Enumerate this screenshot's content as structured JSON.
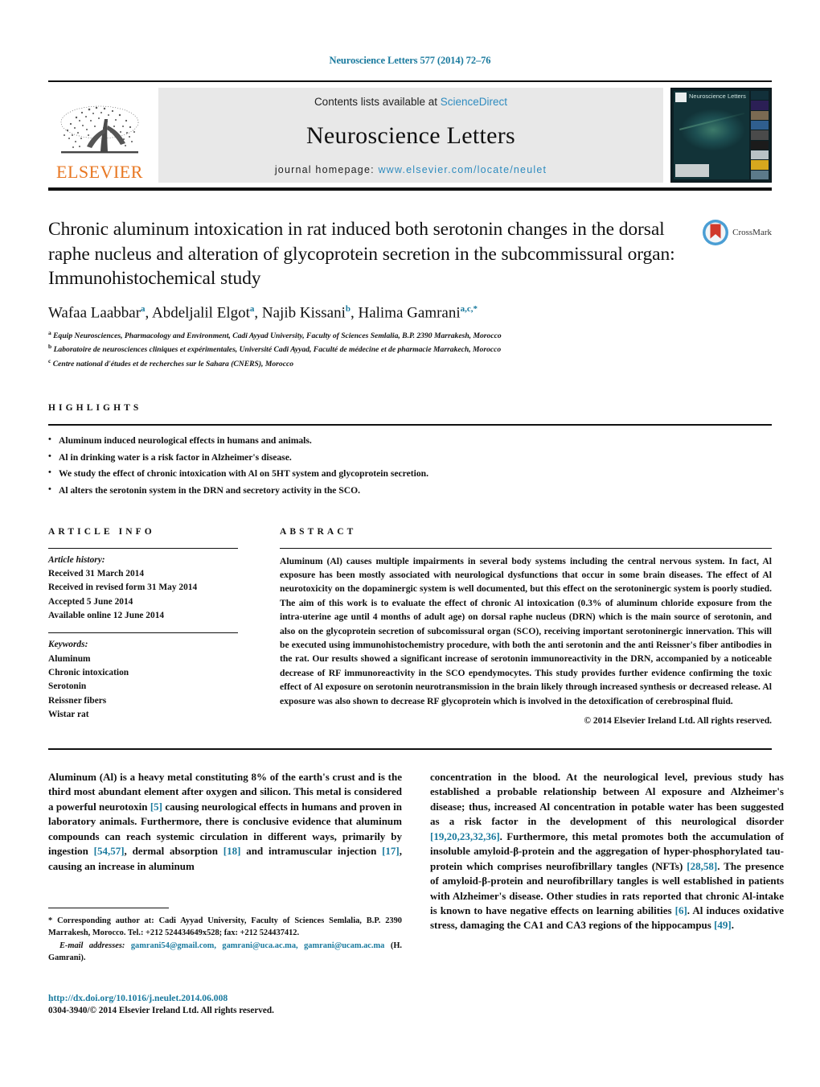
{
  "running_head": "Neuroscience Letters 577 (2014) 72–76",
  "masthead": {
    "publisher_name": "ELSEVIER",
    "contents_prefix": "Contents lists available at ",
    "contents_link": "ScienceDirect",
    "journal_title": "Neuroscience Letters",
    "homepage_prefix": "journal homepage: ",
    "homepage_url": "www.elsevier.com/locate/neulet",
    "cover_title": "Neuroscience Letters",
    "link_color": "#2e8bbf"
  },
  "article": {
    "title": "Chronic aluminum intoxication in rat induced both serotonin changes in the dorsal raphe nucleus and alteration of glycoprotein secretion in the subcommissural organ: Immunohistochemical study",
    "crossmark_label": "CrossMark",
    "authors": [
      {
        "name": "Wafaa Laabbar",
        "marks": "a",
        "sep": ", "
      },
      {
        "name": "Abdeljalil Elgot",
        "marks": "a",
        "sep": ", "
      },
      {
        "name": "Najib Kissani",
        "marks": "b",
        "sep": ", "
      },
      {
        "name": "Halima Gamrani",
        "marks": "a,c,*",
        "sep": ""
      }
    ],
    "affiliations": [
      {
        "mark": "a",
        "text": "Equip Neurosciences, Pharmacology and Environment, Cadi Ayyad University, Faculty of Sciences Semlalia, B.P. 2390 Marrakesh, Morocco"
      },
      {
        "mark": "b",
        "text": "Laboratoire de neurosciences cliniques et expérimentales, Université Cadi Ayyad, Faculté de médecine et de pharmacie Marrakech, Morocco"
      },
      {
        "mark": "c",
        "text": "Centre national d'études et de recherches sur le Sahara (CNERS), Morocco"
      }
    ]
  },
  "highlights": {
    "heading": "HIGHLIGHTS",
    "items": [
      "Aluminum induced neurological effects in humans and animals.",
      "Al in drinking water is a risk factor in Alzheimer's disease.",
      "We study the effect of chronic intoxication with Al on 5HT system and glycoprotein secretion.",
      "Al alters the serotonin system in the DRN and secretory activity in the SCO."
    ]
  },
  "article_info": {
    "heading": "ARTICLE INFO",
    "history_label": "Article history:",
    "history": [
      "Received 31 March 2014",
      "Received in revised form 31 May 2014",
      "Accepted 5 June 2014",
      "Available online 12 June 2014"
    ],
    "keywords_label": "Keywords:",
    "keywords": [
      "Aluminum",
      "Chronic intoxication",
      "Serotonin",
      "Reissner fibers",
      "Wistar rat"
    ]
  },
  "abstract": {
    "heading": "ABSTRACT",
    "text": "Aluminum (Al) causes multiple impairments in several body systems including the central nervous system. In fact, Al exposure has been mostly associated with neurological dysfunctions that occur in some brain diseases. The effect of Al neurotoxicity on the dopaminergic system is well documented, but this effect on the serotoninergic system is poorly studied. The aim of this work is to evaluate the effect of chronic Al intoxication (0.3% of aluminum chloride exposure from the intra-uterine age until 4 months of adult age) on dorsal raphe nucleus (DRN) which is the main source of serotonin, and also on the glycoprotein secretion of subcomissural organ (SCO), receiving important serotoninergic innervation. This will be executed using immunohistochemistry procedure, with both the anti serotonin and the anti Reissner's fiber antibodies in the rat. Our results showed a significant increase of serotonin immunoreactivity in the DRN, accompanied by a noticeable decrease of RF immunoreactivity in the SCO ependymocytes. This study provides further evidence confirming the toxic effect of Al exposure on serotonin neurotransmission in the brain likely through increased synthesis or decreased release. Al exposure was also shown to decrease RF glycoprotein which is involved in the detoxification of cerebrospinal fluid.",
    "copyright": "© 2014 Elsevier Ireland Ltd. All rights reserved."
  },
  "body": {
    "left_column_parts": [
      "Aluminum (Al) is a heavy metal constituting 8% of the earth's crust and is the third most abundant element after oxygen and silicon. This metal is considered a powerful neurotoxin ",
      "[5]",
      " causing neurological effects in humans and proven in laboratory animals. Furthermore, there is conclusive evidence that aluminum compounds can reach systemic circulation in different ways, primarily by ingestion ",
      "[54,57]",
      ", dermal absorption ",
      "[18]",
      " and intramuscular injection ",
      "[17]",
      ", causing an increase in aluminum"
    ],
    "right_column_parts": [
      "concentration in the blood. At the neurological level, previous study has established a probable relationship between Al exposure and Alzheimer's disease; thus, increased Al concentration in potable water has been suggested as a risk factor in the development of this neurological disorder ",
      "[19,20,23,32,36]",
      ". Furthermore, this metal promotes both the accumulation of insoluble amyloid-β-protein and the aggregation of hyper-phosphorylated tau-protein which comprises neurofibrillary tangles (NFTs) ",
      "[28,58]",
      ". The presence of amyloid-β-protein and neurofibrillary tangles is well established in patients with Alzheimer's disease. Other studies in rats reported that chronic Al-intake is known to have negative effects on learning abilities ",
      "[6]",
      ". Al induces oxidative stress, damaging the CA1 and CA3 regions of the hippocampus ",
      "[49]",
      "."
    ]
  },
  "footnotes": {
    "corresponding": "* Corresponding author at: Cadi Ayyad University, Faculty of Sciences Semlalia, B.P. 2390 Marrakesh, Morocco. Tel.: +212 524434649x528; fax: +212 524437412.",
    "email_label": "E-mail addresses:",
    "emails": "gamrani54@gmail.com, gamrani@uca.ac.ma, gamrani@ucam.ac.ma",
    "email_owner": "(H. Gamrani).",
    "doi": "http://dx.doi.org/10.1016/j.neulet.2014.06.008",
    "issn_line": "0304-3940/© 2014 Elsevier Ireland Ltd. All rights reserved.",
    "link_color": "#1a7a9e"
  }
}
